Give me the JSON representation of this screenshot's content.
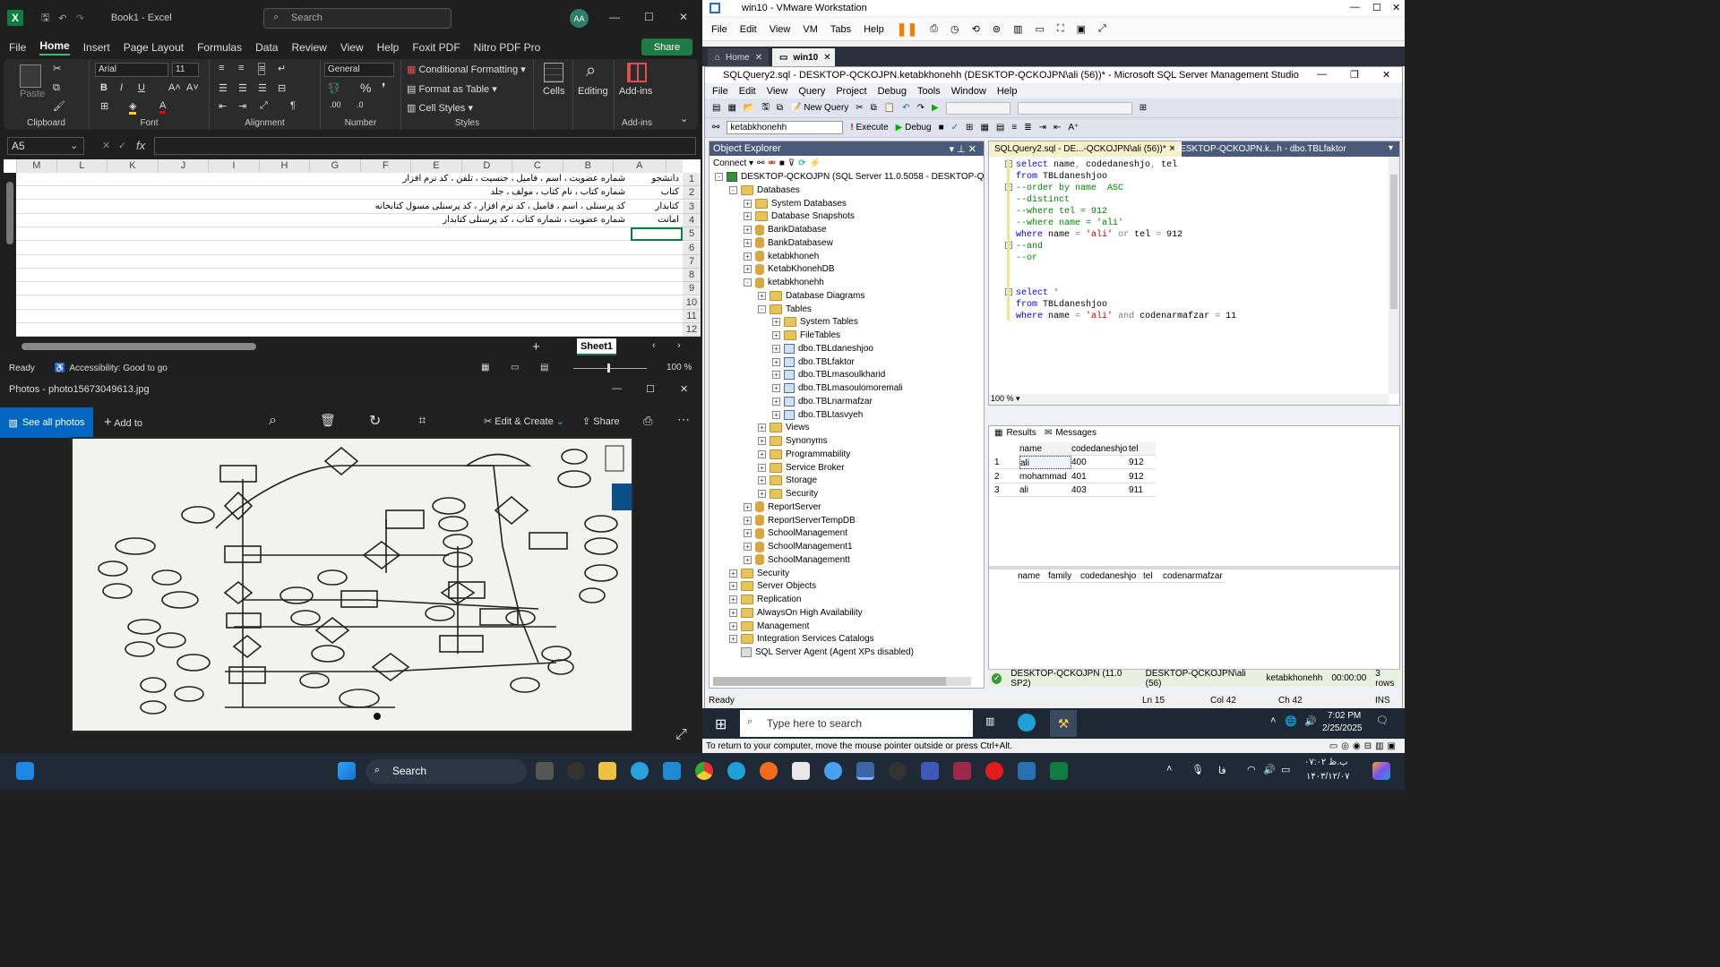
{
  "excel": {
    "title": "Book1 - Excel",
    "search_placeholder": "Search",
    "avatar": "AA",
    "tabs": [
      "File",
      "Home",
      "Insert",
      "Page Layout",
      "Formulas",
      "Data",
      "Review",
      "View",
      "Help",
      "Foxit PDF",
      "Nitro PDF Pro"
    ],
    "share": "Share",
    "ribbon": {
      "paste": "Paste",
      "clipboard": "Clipboard",
      "font_name": "Arial",
      "font_size": "11",
      "font": "Font",
      "alignment": "Alignment",
      "number_format": "General",
      "number": "Number",
      "conditional": "Conditional Formatting",
      "format_table": "Format as Table",
      "cell_styles": "Cell Styles",
      "styles": "Styles",
      "cells": "Cells",
      "editing": "Editing",
      "addins": "Add-ins",
      "addins_group": "Add-ins"
    },
    "name_box": "A5",
    "fx": "fx",
    "columns": [
      "A",
      "B",
      "C",
      "D",
      "E",
      "F",
      "G",
      "H",
      "I",
      "J",
      "K",
      "L",
      "M"
    ],
    "rows": [
      "1",
      "2",
      "3",
      "4",
      "5",
      "6",
      "7",
      "8",
      "9",
      "10",
      "11",
      "12"
    ],
    "cells": [
      {
        "a": "دانشجو",
        "b": "شماره عضویت ، اسم ، فامیل ، جنسیت ، تلفن ، کد نرم افزار"
      },
      {
        "a": "کتاب",
        "b": "شماره کتاب ، نام کتاب ، مولف ، جلد"
      },
      {
        "a": "کتابدار",
        "b": "کد پرسنلی ، اسم ، فامیل ، کد نرم افزار ، کد پرسنلی مسول کتابخانه"
      },
      {
        "a": "امانت",
        "b": "شماره عضویت ، شماره کتاب ، کد پرسنلی کتابدار"
      }
    ],
    "sheet": "Sheet1",
    "status_ready": "Ready",
    "accessibility": "Accessibility: Good to go",
    "zoom": "100 %"
  },
  "photos": {
    "title": "Photos - photo15673049613.jpg",
    "see_all": "See all photos",
    "add_to": "Add to",
    "edit_create": "Edit & Create",
    "share": "Share"
  },
  "vmware": {
    "title": "win10 - VMware Workstation",
    "menu": [
      "File",
      "Edit",
      "View",
      "VM",
      "Tabs",
      "Help"
    ],
    "tabs": [
      "Home",
      "win10"
    ],
    "ssms_title": "SQLQuery2.sql - DESKTOP-QCKOJPN.ketabkhonehh (DESKTOP-QCKOJPN\\ali (56))* - Microsoft SQL Server Management Studio",
    "ssms_menu": [
      "File",
      "Edit",
      "View",
      "Query",
      "Project",
      "Debug",
      "Tools",
      "Window",
      "Help"
    ],
    "new_query": "New Query",
    "db_select": "ketabkhonehh",
    "execute": "Execute",
    "debug": "Debug",
    "object_explorer": "Object Explorer",
    "connect": "Connect",
    "tree": [
      {
        "l": 0,
        "t": "DESKTOP-QCKOJPN (SQL Server 11.0.5058 - DESKTOP-QCKOJPN",
        "k": "srv",
        "e": "-"
      },
      {
        "l": 1,
        "t": "Databases",
        "k": "fold",
        "e": "-"
      },
      {
        "l": 2,
        "t": "System Databases",
        "k": "fold",
        "e": "+"
      },
      {
        "l": 2,
        "t": "Database Snapshots",
        "k": "fold",
        "e": "+"
      },
      {
        "l": 2,
        "t": "BankDatabase",
        "k": "db",
        "e": "+"
      },
      {
        "l": 2,
        "t": "BankDatabasew",
        "k": "db",
        "e": "+"
      },
      {
        "l": 2,
        "t": "ketabkhoneh",
        "k": "db",
        "e": "+"
      },
      {
        "l": 2,
        "t": "KetabKhonehDB",
        "k": "db",
        "e": "+"
      },
      {
        "l": 2,
        "t": "ketabkhonehh",
        "k": "db",
        "e": "-"
      },
      {
        "l": 3,
        "t": "Database Diagrams",
        "k": "fold",
        "e": "+"
      },
      {
        "l": 3,
        "t": "Tables",
        "k": "fold",
        "e": "-"
      },
      {
        "l": 4,
        "t": "System Tables",
        "k": "fold",
        "e": "+"
      },
      {
        "l": 4,
        "t": "FileTables",
        "k": "fold",
        "e": "+"
      },
      {
        "l": 4,
        "t": "dbo.TBLdaneshjoo",
        "k": "tbl",
        "e": "+"
      },
      {
        "l": 4,
        "t": "dbo.TBLfaktor",
        "k": "tbl",
        "e": "+"
      },
      {
        "l": 4,
        "t": "dbo.TBLmasoulkharid",
        "k": "tbl",
        "e": "+"
      },
      {
        "l": 4,
        "t": "dbo.TBLmasoulomoremali",
        "k": "tbl",
        "e": "+"
      },
      {
        "l": 4,
        "t": "dbo.TBLnarmafzar",
        "k": "tbl",
        "e": "+"
      },
      {
        "l": 4,
        "t": "dbo.TBLtasvyeh",
        "k": "tbl",
        "e": "+"
      },
      {
        "l": 3,
        "t": "Views",
        "k": "fold",
        "e": "+"
      },
      {
        "l": 3,
        "t": "Synonyms",
        "k": "fold",
        "e": "+"
      },
      {
        "l": 3,
        "t": "Programmability",
        "k": "fold",
        "e": "+"
      },
      {
        "l": 3,
        "t": "Service Broker",
        "k": "fold",
        "e": "+"
      },
      {
        "l": 3,
        "t": "Storage",
        "k": "fold",
        "e": "+"
      },
      {
        "l": 3,
        "t": "Security",
        "k": "fold",
        "e": "+"
      },
      {
        "l": 2,
        "t": "ReportServer",
        "k": "db",
        "e": "+"
      },
      {
        "l": 2,
        "t": "ReportServerTempDB",
        "k": "db",
        "e": "+"
      },
      {
        "l": 2,
        "t": "SchoolManagement",
        "k": "db",
        "e": "+"
      },
      {
        "l": 2,
        "t": "SchoolManagement1",
        "k": "db",
        "e": "+"
      },
      {
        "l": 2,
        "t": "SchoolManagementt",
        "k": "db",
        "e": "+"
      },
      {
        "l": 1,
        "t": "Security",
        "k": "fold",
        "e": "+"
      },
      {
        "l": 1,
        "t": "Server Objects",
        "k": "fold",
        "e": "+"
      },
      {
        "l": 1,
        "t": "Replication",
        "k": "fold",
        "e": "+"
      },
      {
        "l": 1,
        "t": "AlwaysOn High Availability",
        "k": "fold",
        "e": "+"
      },
      {
        "l": 1,
        "t": "Management",
        "k": "fold",
        "e": "+"
      },
      {
        "l": 1,
        "t": "Integration Services Catalogs",
        "k": "fold",
        "e": "+"
      },
      {
        "l": 1,
        "t": "SQL Server Agent (Agent XPs disabled)",
        "k": "agent",
        "e": ""
      }
    ],
    "editor_tabs": [
      "SQLQuery2.sql - DE...-QCKOJPN\\ali (56))*",
      "DESKTOP-QCKOJPN.k...h - dbo.TBLfaktor"
    ],
    "code": [
      [
        {
          "c": "kw",
          "t": "select "
        },
        {
          "c": "",
          "t": "name"
        },
        {
          "c": "op",
          "t": ", "
        },
        {
          "c": "",
          "t": "codedaneshjo"
        },
        {
          "c": "op",
          "t": ", "
        },
        {
          "c": "",
          "t": "tel"
        }
      ],
      [
        {
          "c": "kw",
          "t": "from "
        },
        {
          "c": "",
          "t": "TBLdaneshjoo"
        }
      ],
      [
        {
          "c": "cm",
          "t": "--order by name  ASC"
        }
      ],
      [
        {
          "c": "cm",
          "t": "--distinct"
        }
      ],
      [
        {
          "c": "cm",
          "t": "--where tel = 912"
        }
      ],
      [
        {
          "c": "cm",
          "t": "--where name = 'ali'"
        }
      ],
      [
        {
          "c": "kw",
          "t": "where "
        },
        {
          "c": "",
          "t": "name "
        },
        {
          "c": "op",
          "t": "= "
        },
        {
          "c": "st",
          "t": "'ali'"
        },
        {
          "c": "op",
          "t": " or "
        },
        {
          "c": "",
          "t": "tel "
        },
        {
          "c": "op",
          "t": "= "
        },
        {
          "c": "",
          "t": "912"
        }
      ],
      [
        {
          "c": "cm",
          "t": "--and"
        }
      ],
      [
        {
          "c": "cm",
          "t": "--or"
        }
      ],
      [],
      [],
      [
        {
          "c": "kw",
          "t": "select "
        },
        {
          "c": "op",
          "t": "*"
        }
      ],
      [
        {
          "c": "kw",
          "t": "from "
        },
        {
          "c": "",
          "t": "TBLdaneshjoo"
        }
      ],
      [
        {
          "c": "kw",
          "t": "where "
        },
        {
          "c": "",
          "t": "name "
        },
        {
          "c": "op",
          "t": "= "
        },
        {
          "c": "st",
          "t": "'ali'"
        },
        {
          "c": "op",
          "t": " and "
        },
        {
          "c": "",
          "t": "codenarmafzar "
        },
        {
          "c": "op",
          "t": "= "
        },
        {
          "c": "",
          "t": "11"
        }
      ]
    ],
    "zoom": "100 %",
    "results_tab": "Results",
    "messages_tab": "Messages",
    "grid1_headers": [
      "name",
      "codedaneshjo",
      "tel"
    ],
    "grid1_rows": [
      [
        "1",
        "ali",
        "400",
        "912"
      ],
      [
        "2",
        "mohammad",
        "401",
        "912"
      ],
      [
        "3",
        "ali",
        "403",
        "911"
      ]
    ],
    "grid2_headers": [
      "name",
      "family",
      "codedaneshjo",
      "tel",
      "codenarmafzar"
    ],
    "status_items": [
      "DESKTOP-QCKOJPN (11.0 SP2)",
      "DESKTOP-QCKOJPN\\ali (56)",
      "ketabkhonehh",
      "00:00:00",
      "3 rows"
    ],
    "ready": "Ready",
    "ln": "Ln 15",
    "col": "Col 42",
    "ch": "Ch 42",
    "ins": "INS",
    "guest_search": "Type here to search",
    "guest_time": "7:02 PM",
    "guest_date": "2/25/2025",
    "footer": "To return to your computer, move the mouse pointer outside or press Ctrl+Alt."
  },
  "taskbar": {
    "search": "Search",
    "time": "۰۷:۰۲ ب.ظ",
    "date": "۱۴۰۳/۱۲/۰۷",
    "lang": "فا"
  }
}
